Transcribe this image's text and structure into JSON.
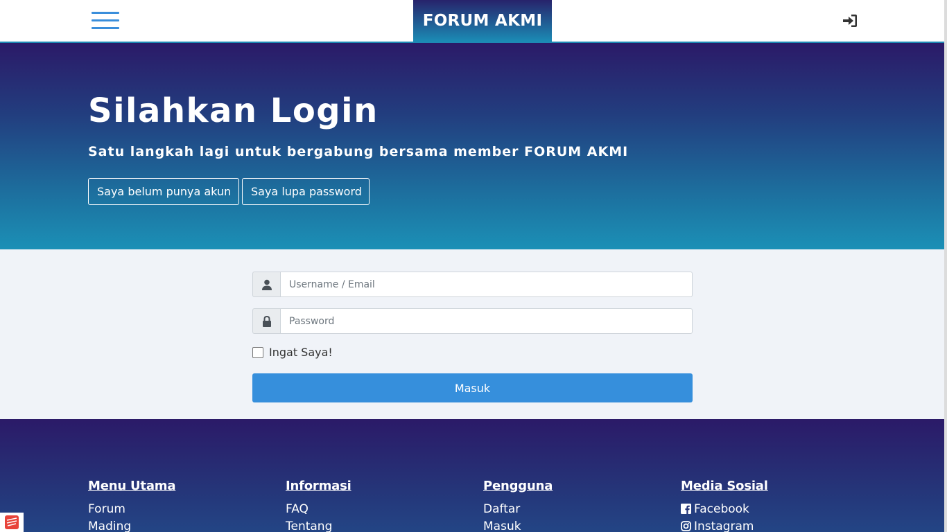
{
  "navbar": {
    "brand": "FORUM AKMI",
    "menu_icon": "hamburger-menu-icon",
    "login_icon": "sign-in-icon"
  },
  "hero": {
    "title": "Silahkan Login",
    "subtitle": "Satu langkah lagi untuk bergabung bersama member FORUM AKMI",
    "register_button": "Saya belum punya akun",
    "forgot_button": "Saya lupa password"
  },
  "login": {
    "username_placeholder": "Username / Email",
    "username_value": "",
    "password_placeholder": "Password",
    "password_value": "",
    "remember_label": "Ingat Saya!",
    "remember_checked": false,
    "submit_label": "Masuk"
  },
  "footer": {
    "columns": [
      {
        "heading": "Menu Utama",
        "links": [
          "Forum",
          "Mading"
        ]
      },
      {
        "heading": "Informasi",
        "links": [
          "FAQ",
          "Tentang"
        ]
      },
      {
        "heading": "Pengguna",
        "links": [
          "Daftar",
          "Masuk"
        ]
      },
      {
        "heading": "Media Sosial",
        "links": [
          "Facebook",
          "Instagram"
        ],
        "icons": [
          "facebook-icon",
          "instagram-icon"
        ]
      }
    ]
  },
  "colors": {
    "accent": "#368fdc",
    "hero_top": "#2b1a68",
    "hero_bottom": "#1b90b6",
    "form_bg": "#f0f3f8"
  }
}
